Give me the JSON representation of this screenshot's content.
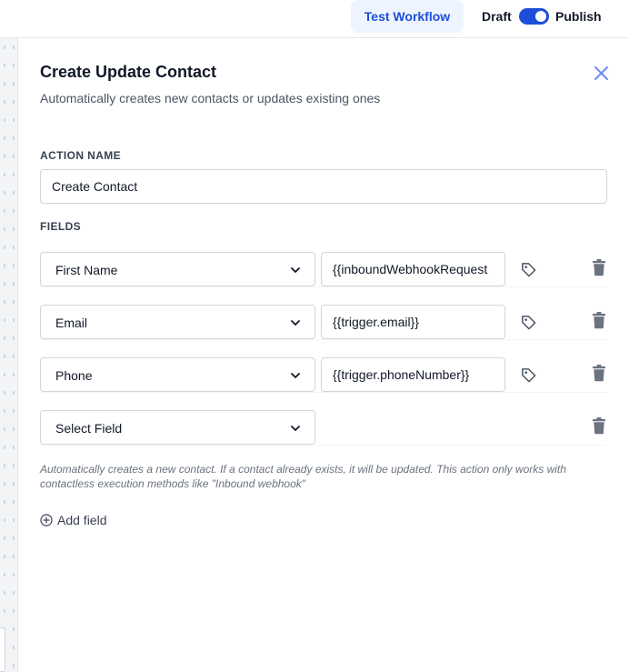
{
  "topbar": {
    "test_workflow_label": "Test Workflow",
    "draft_label": "Draft",
    "publish_label": "Publish",
    "publish_toggle_on": true
  },
  "panel": {
    "title": "Create Update Contact",
    "subtitle": "Automatically creates new contacts or updates existing ones",
    "action_name_label": "ACTION NAME",
    "action_name_value": "Create Contact",
    "fields_label": "FIELDS",
    "fields": [
      {
        "field": "First Name",
        "value": "{{inboundWebhookRequest"
      },
      {
        "field": "Email",
        "value": "{{trigger.email}}"
      },
      {
        "field": "Phone",
        "value": "{{trigger.phoneNumber}}"
      },
      {
        "field": "Select Field",
        "value": null
      }
    ],
    "helper_text": "Automatically creates a new contact. If a contact already exists, it will be updated. This action only works with contactless execution methods like \"Inbound webhook\"",
    "add_field_label": "Add field"
  },
  "colors": {
    "accent": "#1d4ed8",
    "accent_light": "#eef4fe",
    "close_icon": "#6b8cf0",
    "trash_icon": "#6b7280"
  },
  "icons": [
    "close-icon",
    "chevron-down-icon",
    "tag-icon",
    "trash-icon",
    "plus-circle-icon"
  ]
}
